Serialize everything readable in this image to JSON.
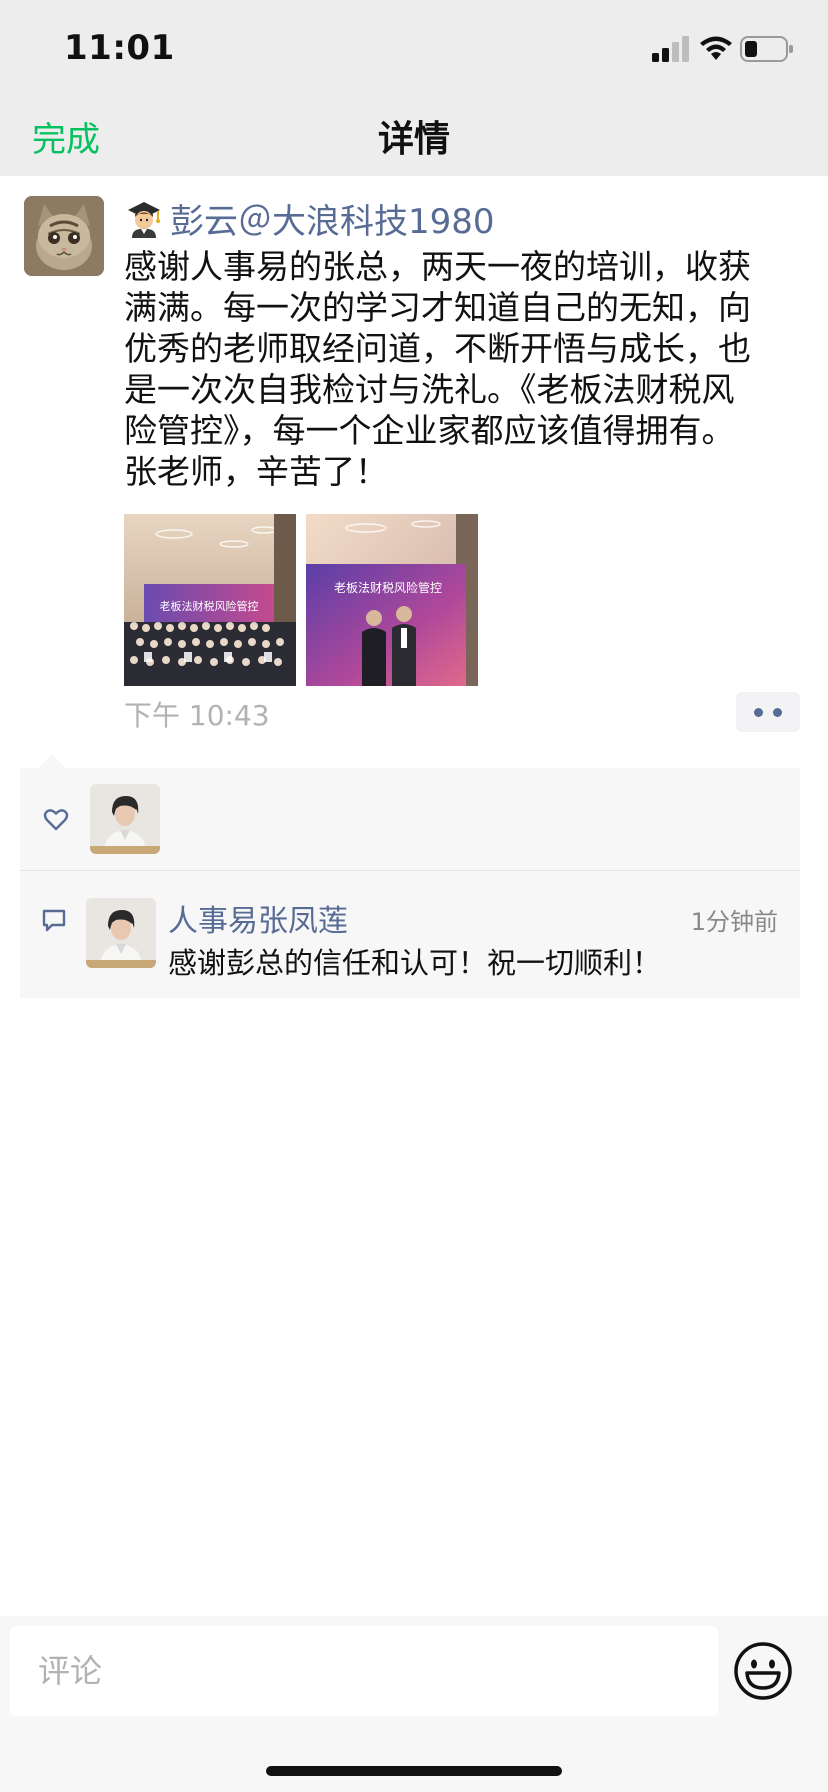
{
  "status_bar": {
    "time": "11:01"
  },
  "nav": {
    "done_label": "完成",
    "title": "详情"
  },
  "post": {
    "author": "彭云＠大浪科技1980",
    "lines": [
      "感谢人事易的张总，两天一夜的培训，收获",
      "满满。每一次的学习才知道自己的无知，向",
      "优秀的老师取经问道，不断开悟与成长，也",
      "是一次次自我检讨与洗礼。《老板法财税风",
      "险管控》，每一个企业家都应该值得拥有。",
      "张老师，辛苦了！"
    ],
    "photo_banner_text": "老板法财税风险管控",
    "time": "下午 10:43"
  },
  "comments": [
    {
      "name": "人事易张凤莲",
      "time": "1分钟前",
      "text": "感谢彭总的信任和认可！祝一切顺利！"
    }
  ],
  "input": {
    "placeholder": "评论"
  },
  "colors": {
    "accent_green": "#07c160",
    "link_blue": "#576b95",
    "gray_text": "#b2b2b2"
  }
}
